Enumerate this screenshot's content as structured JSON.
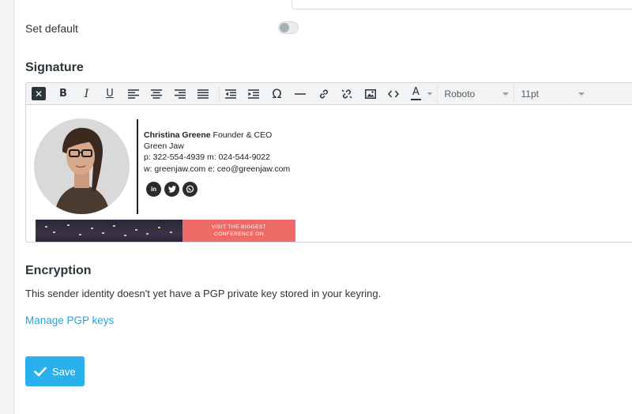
{
  "settings": {
    "set_default_label": "Set default",
    "set_default_on": false
  },
  "signature": {
    "section_title": "Signature",
    "toolbar": {
      "font_family": "Roboto",
      "font_size": "11pt",
      "buttons": [
        "close-icon",
        "bold-icon",
        "italic-icon",
        "underline-icon",
        "align-left-icon",
        "align-center-icon",
        "align-right-icon",
        "align-justify-icon",
        "outdent-icon",
        "indent-icon",
        "special-char-icon",
        "horizontal-rule-icon",
        "link-icon",
        "unlink-icon",
        "image-icon",
        "source-code-icon",
        "text-color-icon"
      ]
    },
    "card": {
      "name": "Christina Greene",
      "title": "Founder & CEO",
      "company": "Green Jaw",
      "phone_line": "p: 322-554-4939 m: 024-544-9022",
      "web_line": "w: greenjaw.com e: ceo@greenjaw.com",
      "socials": [
        "linkedin-icon",
        "twitter-icon",
        "whatsapp-icon"
      ],
      "banner_line1": "VISIT THE BIGGEST",
      "banner_line2": "CONFERENCE ON"
    }
  },
  "encryption": {
    "section_title": "Encryption",
    "description": "This sender identity doesn't yet have a PGP private key stored in your keyring.",
    "manage_link": "Manage PGP keys"
  },
  "actions": {
    "save_label": "Save"
  },
  "colors": {
    "accent": "#2ab0ec",
    "link": "#1ea7e1",
    "banner": "#ee6a66"
  }
}
